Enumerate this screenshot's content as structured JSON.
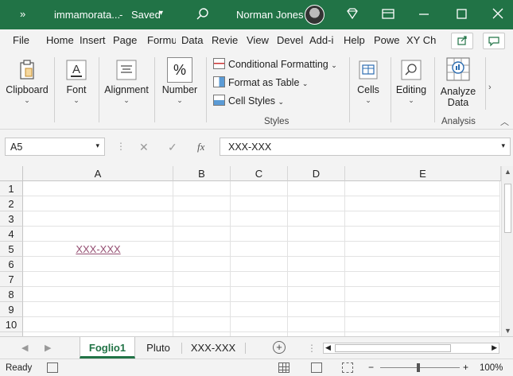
{
  "titlebar": {
    "filename": "immamorata...",
    "save_state": "Saved",
    "user_name": "Norman Jones"
  },
  "tabs": [
    {
      "label": "File"
    },
    {
      "label": "Home"
    },
    {
      "label": "Insert"
    },
    {
      "label": "Page"
    },
    {
      "label": "Formu"
    },
    {
      "label": "Data"
    },
    {
      "label": "Revie"
    },
    {
      "label": "View"
    },
    {
      "label": "Devel"
    },
    {
      "label": "Add-i"
    },
    {
      "label": "Help"
    },
    {
      "label": "Powe"
    },
    {
      "label": "XY Ch"
    }
  ],
  "ribbon": {
    "clipboard": "Clipboard",
    "font": "Font",
    "alignment": "Alignment",
    "number": "Number",
    "number_icon": "%",
    "conditional_formatting": "Conditional Formatting",
    "format_as_table": "Format as Table",
    "cell_styles": "Cell Styles",
    "styles_group": "Styles",
    "cells": "Cells",
    "editing": "Editing",
    "analyze_data": "Analyze Data",
    "analyze_line1": "Analyze",
    "analyze_line2": "Data",
    "analysis_group": "Analysis"
  },
  "formula_bar": {
    "name_box": "A5",
    "fx": "fx",
    "content": "XXX-XXX"
  },
  "grid": {
    "columns": [
      "A",
      "B",
      "C",
      "D",
      "E"
    ],
    "rows": [
      "1",
      "2",
      "3",
      "4",
      "5",
      "6",
      "7",
      "8",
      "9",
      "10"
    ],
    "cell_a5": "XXX-XXX"
  },
  "sheets": [
    {
      "label": "Foglio1",
      "active": true
    },
    {
      "label": "Pluto",
      "active": false
    },
    {
      "label": "XXX-XXX",
      "active": false
    }
  ],
  "status": {
    "ready": "Ready",
    "zoom": "100%"
  },
  "colors": {
    "brand": "#217346",
    "hyperlink": "#954f72"
  }
}
